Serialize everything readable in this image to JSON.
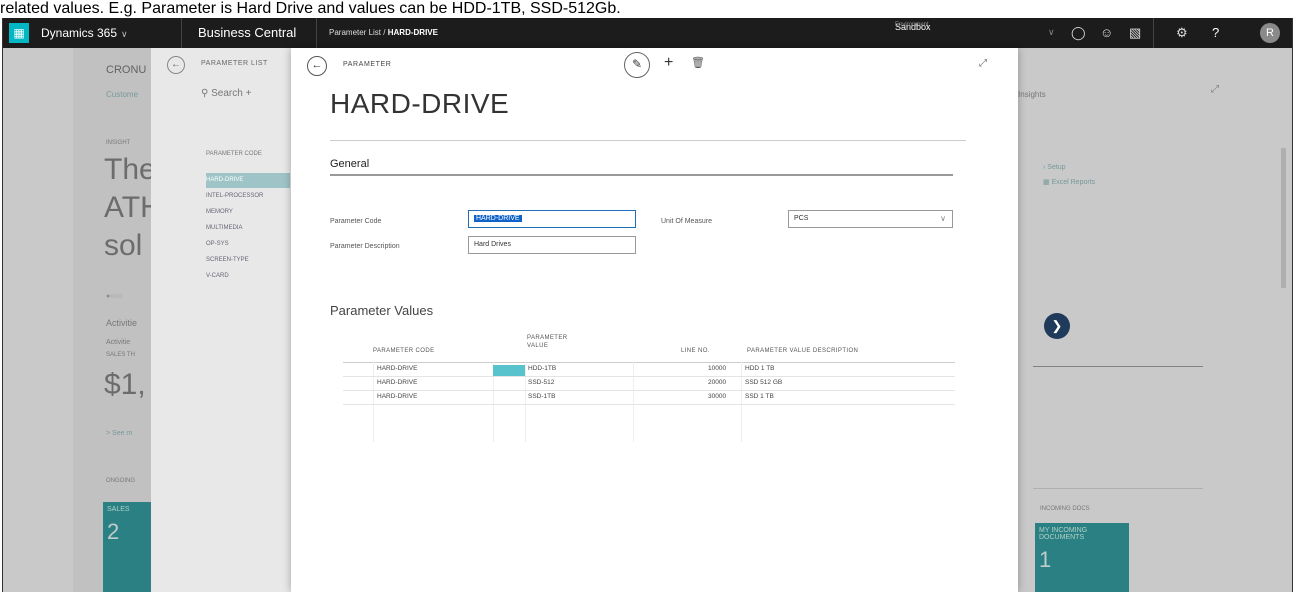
{
  "caption": "related values. E.g. Parameter is Hard Drive and values can be HDD-1TB, SSD-512Gb.",
  "topbar": {
    "dynamics": "Dynamics 365",
    "app": "Business Central",
    "breadcrumb_list": "Parameter List",
    "breadcrumb_sep": "/",
    "breadcrumb_record": "HARD-DRIVE",
    "env_label": "Environment",
    "env_value": "Sandbox",
    "help": "?",
    "avatar": "R"
  },
  "background": {
    "company": "CRONU",
    "customer": "Custome",
    "insight": "INSIGHT",
    "hero1": "The",
    "hero2": "ATH",
    "hero3": "sol",
    "activities": "Activitie",
    "activities2": "Activitie",
    "sales_this": "SALES TH",
    "amount": "$1,",
    "see_more": "> See m",
    "ongoing": "ONGOING",
    "sales_tile_label": "SALES",
    "sales_tile_value": "2",
    "insights": "Insights",
    "setup": "Setup",
    "excel_reports": "Excel Reports",
    "incoming": "INCOMING DOCS",
    "incoming_tile_label": "MY INCOMING DOCUMENTS",
    "incoming_tile_value": "1"
  },
  "list": {
    "title": "PARAMETER LIST",
    "search": "Search",
    "column": "PARAMETER CODE",
    "items": [
      "HARD-DRIVE",
      "INTEL-PROCESSOR",
      "MEMORY",
      "MULTIMEDIA",
      "OP-SYS",
      "SCREEN-TYPE",
      "V-CARD"
    ]
  },
  "card": {
    "caption": "PARAMETER",
    "heading": "HARD-DRIVE",
    "group_general": "General",
    "param_code_label": "Parameter Code",
    "param_code_value": "HARD-DRIVE",
    "param_desc_label": "Parameter Description",
    "param_desc_value": "Hard Drives",
    "uom_label": "Unit Of Measure",
    "uom_value": "PCS",
    "section_values": "Parameter Values",
    "grid_headers": {
      "code": "PARAMETER CODE",
      "value_l1": "PARAMETER",
      "value_l2": "VALUE",
      "line": "LINE NO.",
      "desc": "PARAMETER VALUE DESCRIPTION"
    },
    "rows": [
      {
        "code": "HARD-DRIVE",
        "value": "HDD-1TB",
        "line": "10000",
        "desc": "HDD 1 TB"
      },
      {
        "code": "HARD-DRIVE",
        "value": "SSD-512",
        "line": "20000",
        "desc": "SSD 512 GB"
      },
      {
        "code": "HARD-DRIVE",
        "value": "SSD-1TB",
        "line": "30000",
        "desc": "SSD 1 TB"
      }
    ]
  }
}
